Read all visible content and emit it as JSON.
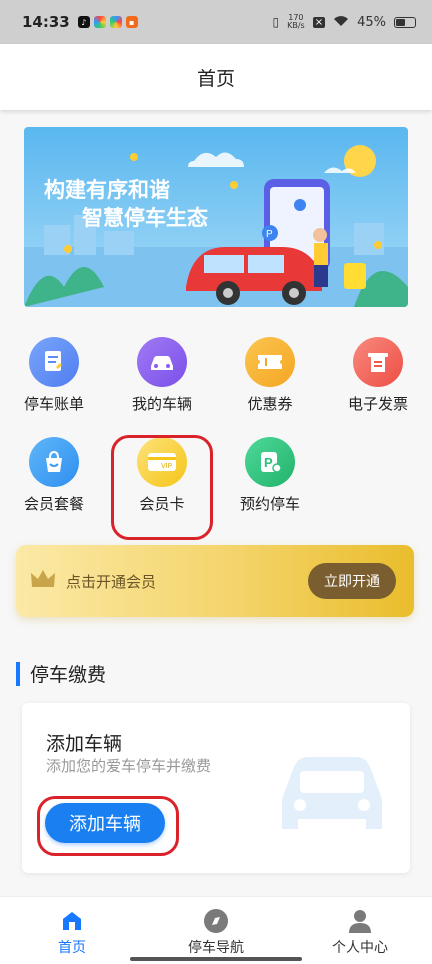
{
  "status_bar": {
    "time": "14:33",
    "net_speed_value": "170",
    "net_speed_unit": "KB/s",
    "battery": "45%"
  },
  "header": {
    "title": "首页"
  },
  "banner": {
    "line1": "构建有序和谐",
    "line2": "智慧停车生态"
  },
  "quick_actions": [
    {
      "label": "停车账单",
      "icon": "bill-icon",
      "color": "#5b8ef5"
    },
    {
      "label": "我的车辆",
      "icon": "car-icon",
      "color": "#8a5cf0"
    },
    {
      "label": "优惠券",
      "icon": "coupon-icon",
      "color": "#f5a623"
    },
    {
      "label": "电子发票",
      "icon": "invoice-icon",
      "color": "#f0564a"
    },
    {
      "label": "会员套餐",
      "icon": "package-icon",
      "color": "#3b9cf0"
    },
    {
      "label": "会员卡",
      "icon": "vip-card-icon",
      "color": "#f5c518"
    },
    {
      "label": "预约停车",
      "icon": "reserve-parking-icon",
      "color": "#2fc17a"
    }
  ],
  "vip_bar": {
    "text": "点击开通会员",
    "button": "立即开通"
  },
  "section": {
    "title": "停车缴费"
  },
  "add_vehicle_card": {
    "title": "添加车辆",
    "subtitle": "添加您的爱车停车并缴费",
    "button": "添加车辆"
  },
  "tabbar": {
    "items": [
      {
        "label": "首页",
        "icon": "home-icon",
        "active": true
      },
      {
        "label": "停车导航",
        "icon": "compass-icon",
        "active": false
      },
      {
        "label": "个人中心",
        "icon": "user-icon",
        "active": false
      }
    ]
  },
  "colors": {
    "accent": "#1677ff",
    "highlight": "#d9222a",
    "vip_gold": "#f4d46a"
  }
}
